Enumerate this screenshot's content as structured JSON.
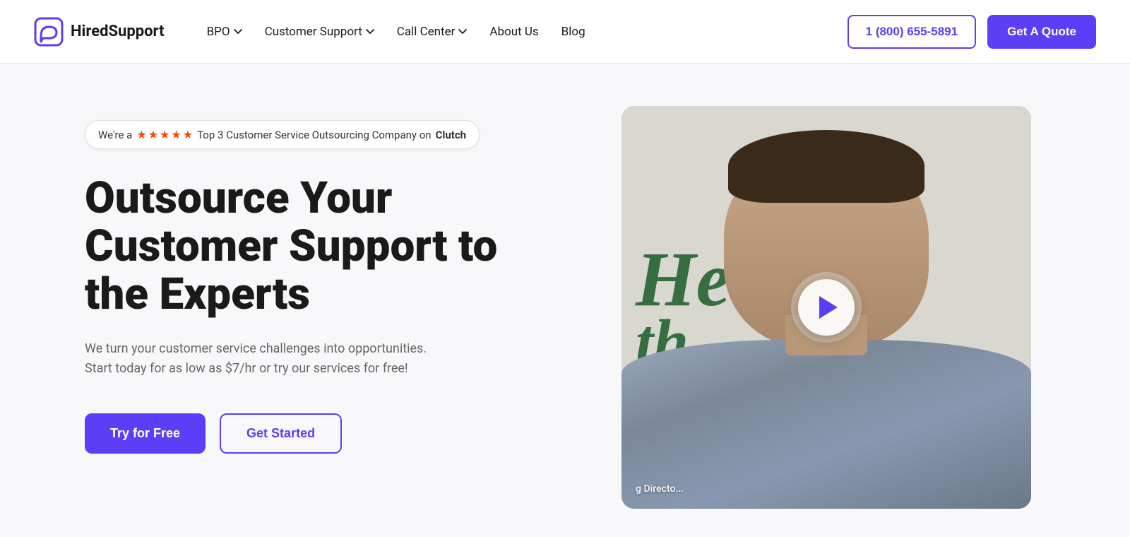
{
  "logo": {
    "text": "HiredSupport"
  },
  "nav": {
    "items": [
      {
        "label": "BPO",
        "has_dropdown": true
      },
      {
        "label": "Customer Support",
        "has_dropdown": true
      },
      {
        "label": "Call Center",
        "has_dropdown": true
      },
      {
        "label": "About Us",
        "has_dropdown": false
      },
      {
        "label": "Blog",
        "has_dropdown": false
      }
    ],
    "phone": "1 (800) 655-5891",
    "quote_btn": "Get A Quote"
  },
  "hero": {
    "badge": {
      "prefix": "We're a",
      "stars": 5,
      "suffix_plain": "Top 3 Customer Service Outsourcing Company on",
      "suffix_bold": "Clutch"
    },
    "title": "Outsource Your Customer Support to the Experts",
    "subtitle": "We turn your customer service challenges into opportunities. Start today for as low as $7/hr or try our services for free!",
    "btn_primary": "Try for Free",
    "btn_secondary": "Get Started"
  },
  "video": {
    "caption": "g Directo..."
  }
}
